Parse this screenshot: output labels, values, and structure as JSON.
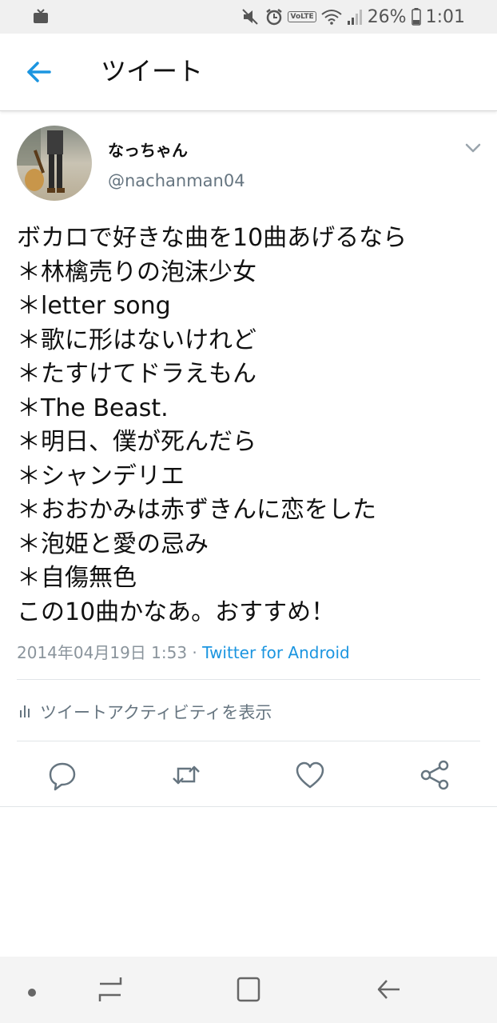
{
  "status_bar": {
    "battery_percent": "26%",
    "time": "1:01",
    "volte_label": "VoLTE",
    "icons": [
      "tv-icon",
      "mute-icon",
      "alarm-icon",
      "volte-icon",
      "wifi-icon",
      "signal-icon",
      "battery-icon"
    ]
  },
  "app_bar": {
    "title": "ツイート",
    "back_icon": "back-arrow-icon"
  },
  "tweet": {
    "author_name": "なっちゃん",
    "author_handle": "@nachanman04",
    "lines": [
      "ボカロで好きな曲を10曲あげるなら",
      "＊林檎売りの泡沫少女",
      "＊letter song",
      "＊歌に形はないけれど",
      "＊たすけてドラえもん",
      "＊The Beast.",
      "＊明日、僕が死んだら",
      "＊シャンデリエ",
      "＊おおかみは赤ずきんに恋をした",
      "＊泡姫と愛の忌み",
      "＊自傷無色",
      "この10曲かなあ。おすすめ！"
    ],
    "timestamp": "2014年04月19日 1:53",
    "separator": " · ",
    "via": "Twitter for Android",
    "activity_label": "ツイートアクティビティを表示"
  },
  "actions": [
    "reply-icon",
    "retweet-icon",
    "like-icon",
    "share-icon"
  ],
  "colors": {
    "accent": "#1b95e0",
    "secondary_text": "#667580",
    "status_bar_bg": "#f0f0f0",
    "nav_bar_bg": "#f4f4f4"
  },
  "nav_bar": [
    "nav-dot-icon",
    "recent-apps-icon",
    "home-icon",
    "back-icon"
  ]
}
